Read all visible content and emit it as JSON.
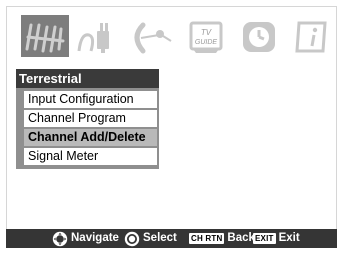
{
  "icons": [
    {
      "name": "antenna-icon",
      "selected": true
    },
    {
      "name": "plug-icon",
      "selected": false
    },
    {
      "name": "satellite-dish-icon",
      "selected": false
    },
    {
      "name": "tv-guide-icon",
      "selected": false,
      "label_top": "TV",
      "label_bottom": "GUIDE"
    },
    {
      "name": "clock-icon",
      "selected": false
    },
    {
      "name": "info-icon",
      "selected": false
    }
  ],
  "menu": {
    "title": "Terrestrial",
    "items": [
      {
        "label": "Input Configuration",
        "active": false
      },
      {
        "label": "Channel Program",
        "active": false
      },
      {
        "label": "Channel Add/Delete",
        "active": true
      },
      {
        "label": "Signal Meter",
        "active": false
      }
    ]
  },
  "footer": {
    "navigate_label": "Navigate",
    "select_label": "Select",
    "back_badge": "CH RTN",
    "back_label": "Back",
    "exit_badge": "EXIT",
    "exit_label": "Exit"
  },
  "colors": {
    "header_bg": "#3a3a3a",
    "panel_bg": "#8f8f8f",
    "active_item_bg": "#b9b9b9",
    "footer_bg": "#353535",
    "selected_icon_bg": "#7d7d7d",
    "icon_fill": "#c8c8c8"
  }
}
